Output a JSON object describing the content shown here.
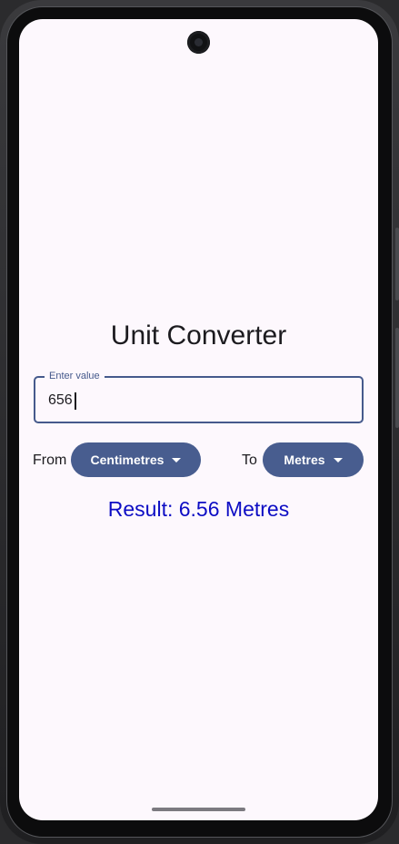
{
  "app": {
    "title": "Unit Converter"
  },
  "input": {
    "label": "Enter value",
    "value": "656"
  },
  "from": {
    "label": "From",
    "selected": "Centimetres"
  },
  "to": {
    "label": "To",
    "selected": "Metres"
  },
  "result": {
    "text": "Result: 6.56 Metres"
  },
  "colors": {
    "primary": "#485d8f",
    "result_text": "#0d0dc4",
    "background": "#fdf8fd"
  },
  "icons": {
    "dropdown": "caret-down-icon",
    "camera": "camera-cutout"
  }
}
